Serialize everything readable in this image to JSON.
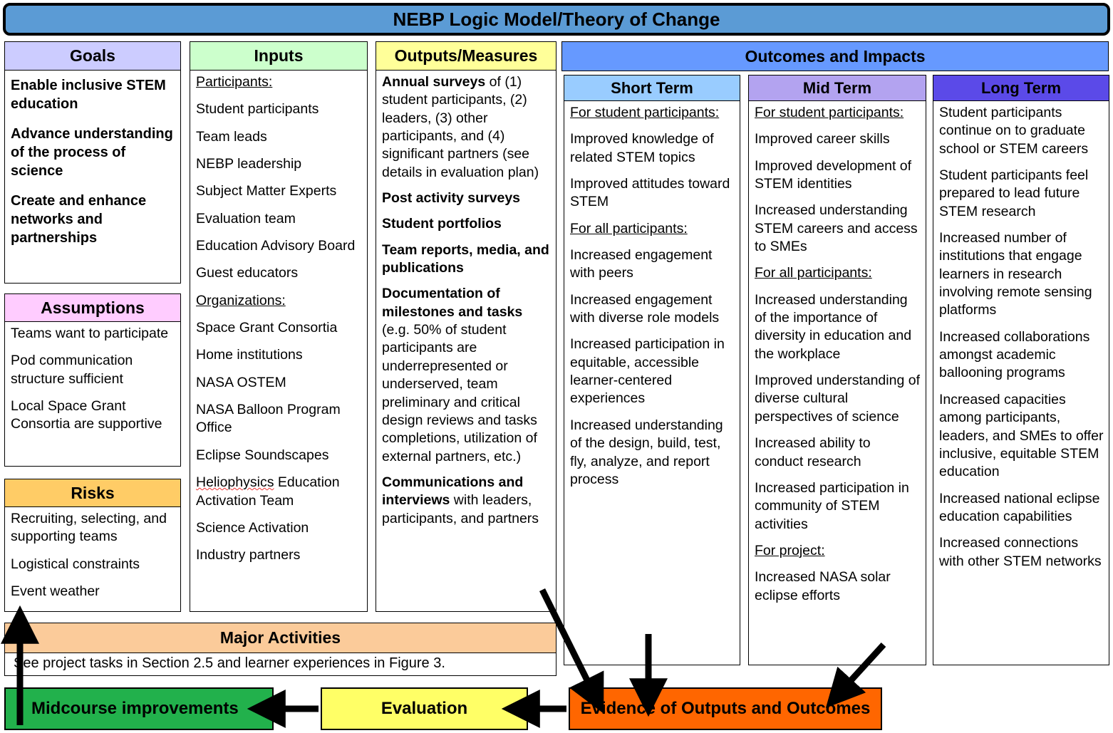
{
  "title": "NEBP Logic Model/Theory of Change",
  "columns": {
    "goals": {
      "header": "Goals",
      "items": [
        "Enable inclusive STEM education",
        "Advance understanding of the process of science",
        "Create and enhance networks and partnerships"
      ]
    },
    "assumptions": {
      "header": "Assumptions",
      "items": [
        "Teams want to participate",
        "Pod communication structure sufficient",
        "Local Space Grant Consortia are supportive"
      ]
    },
    "risks": {
      "header": "Risks",
      "items": [
        "Recruiting, selecting, and supporting teams",
        "Logistical constraints",
        "Event weather"
      ]
    },
    "inputs": {
      "header": "Inputs",
      "subhead_participants": "Participants:",
      "participants": [
        "Student participants",
        "Team leads",
        "NEBP leadership",
        "Subject Matter Experts",
        "Evaluation team",
        "Education Advisory Board",
        "Guest educators"
      ],
      "subhead_organizations": "Organizations:",
      "organizations": [
        "Space Grant Consortia",
        "Home institutions",
        "NASA OSTEM",
        "NASA Balloon Program Office",
        "Eclipse Soundscapes",
        "Heliophysics Education Activation Team",
        "Science Activation",
        "Industry partners"
      ],
      "squiggle_word": "Heliophysics",
      "squiggle_rest": " Education Activation Team"
    },
    "outputs": {
      "header": "Outputs/Measures",
      "items": [
        {
          "bold": "Annual surveys",
          "rest": " of (1) student participants, (2) leaders, (3) other participants, and (4) significant partners (see details in evaluation plan)"
        },
        {
          "bold": "Post activity surveys",
          "rest": ""
        },
        {
          "bold": "Student portfolios",
          "rest": ""
        },
        {
          "bold": "Team reports, media, and publications",
          "rest": ""
        },
        {
          "bold": "Documentation of milestones and tasks",
          "rest": " (e.g. 50% of student participants are underrepresented or underserved, team preliminary and critical design reviews and tasks completions, utilization of external partners, etc.)"
        },
        {
          "bold": "Communications and interviews",
          "rest": " with leaders, participants, and partners"
        }
      ]
    },
    "outcomes": {
      "header": "Outcomes and Impacts",
      "short_term": {
        "header": "Short Term",
        "blocks": [
          {
            "head": "For student participants:",
            "items": [
              "Improved knowledge of related STEM topics",
              "Improved attitudes toward STEM"
            ]
          },
          {
            "head": "For all participants:",
            "items": [
              "Increased engagement with peers",
              "Increased engagement with diverse role models",
              "Increased participation in equitable, accessible learner-centered experiences",
              "Increased understanding of the design, build, test, fly, analyze, and report process"
            ]
          }
        ]
      },
      "mid_term": {
        "header": "Mid Term",
        "blocks": [
          {
            "head": "For student participants:",
            "items": [
              "Improved career skills",
              "Improved development of STEM identities",
              "Increased understanding STEM careers and access to SMEs"
            ]
          },
          {
            "head": "For all participants:",
            "items": [
              "Increased understanding of the importance of diversity in education and the workplace",
              "Improved understanding of diverse cultural perspectives of science",
              "Increased ability to conduct research",
              "Increased participation in community of STEM activities"
            ]
          },
          {
            "head": "For project:",
            "items": [
              "Increased NASA solar eclipse efforts"
            ]
          }
        ]
      },
      "long_term": {
        "header": "Long Term",
        "blocks": [
          {
            "head": "",
            "items": [
              "Student participants continue on to graduate school or STEM careers",
              "Student participants feel prepared to lead future STEM research",
              "Increased number of institutions that engage learners in research involving remote sensing platforms",
              "Increased collaborations amongst academic ballooning programs",
              "Increased capacities among participants, leaders, and SMEs to offer inclusive, equitable STEM education",
              "Increased national eclipse education capabilities",
              "Increased connections with other STEM networks"
            ]
          }
        ]
      }
    }
  },
  "major_activities": {
    "header": "Major Activities",
    "body": "See project tasks in Section 2.5 and learner experiences in Figure 3."
  },
  "bottom": {
    "midcourse": "Midcourse improvements",
    "evaluation": "Evaluation",
    "evidence": "Evidence of Outputs and Outcomes"
  },
  "colors": {
    "title_banner": "#5b9bd5",
    "goals": "#ccccff",
    "assumptions": "#ffccff",
    "risks": "#ffcc66",
    "inputs": "#ccffcc",
    "outputs": "#ffff99",
    "outcomes": "#6699ff",
    "short_term": "#99ccff",
    "mid_term": "#b3a3f0",
    "long_term": "#5b4ae8",
    "major_activities": "#fbcb9a",
    "midcourse": "#22b14c",
    "evaluation": "#ffff66",
    "evidence": "#ff6600"
  }
}
